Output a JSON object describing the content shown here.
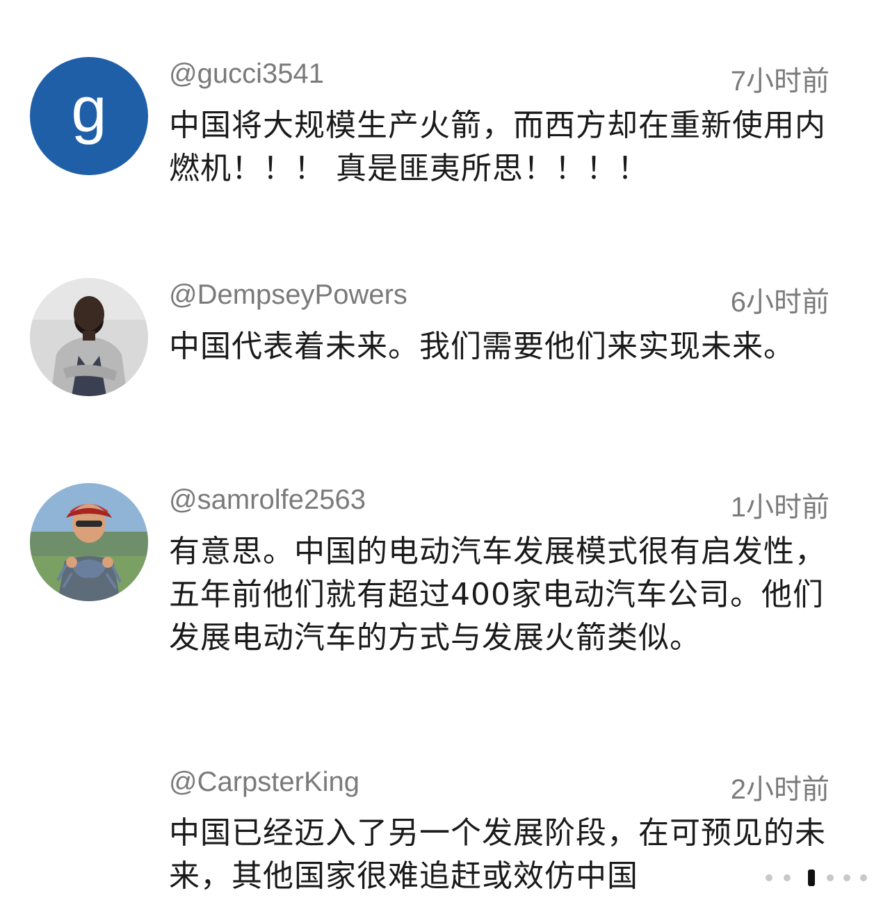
{
  "comments": [
    {
      "username": "@gucci3541",
      "time": "7小时前",
      "avatar_letter": "g",
      "avatar_color": "#1f5fa8",
      "text": "中国将大规模生产火箭，而西方却在重新使用内燃机！！！ 真是匪夷所思！！！！"
    },
    {
      "username": "@DempseyPowers",
      "time": "6小时前",
      "avatar_icon": "person-photo-icon",
      "text": "中国代表着未来。我们需要他们来实现未来。"
    },
    {
      "username": "@samrolfe2563",
      "time": "1小时前",
      "avatar_icon": "person-with-crab-photo-icon",
      "text": "有意思。中国的电动汽车发展模式很有启发性，五年前他们就有超过400家电动汽车公司。他们发展电动汽车的方式与发展火箭类似。"
    },
    {
      "username": "@CarpsterKing",
      "time": "2小时前",
      "text": "中国已经迈入了另一个发展阶段，在可预见的未来，其他国家很难追赶或效仿中国"
    }
  ],
  "page_indicator_icon": "page-indicator-icon"
}
